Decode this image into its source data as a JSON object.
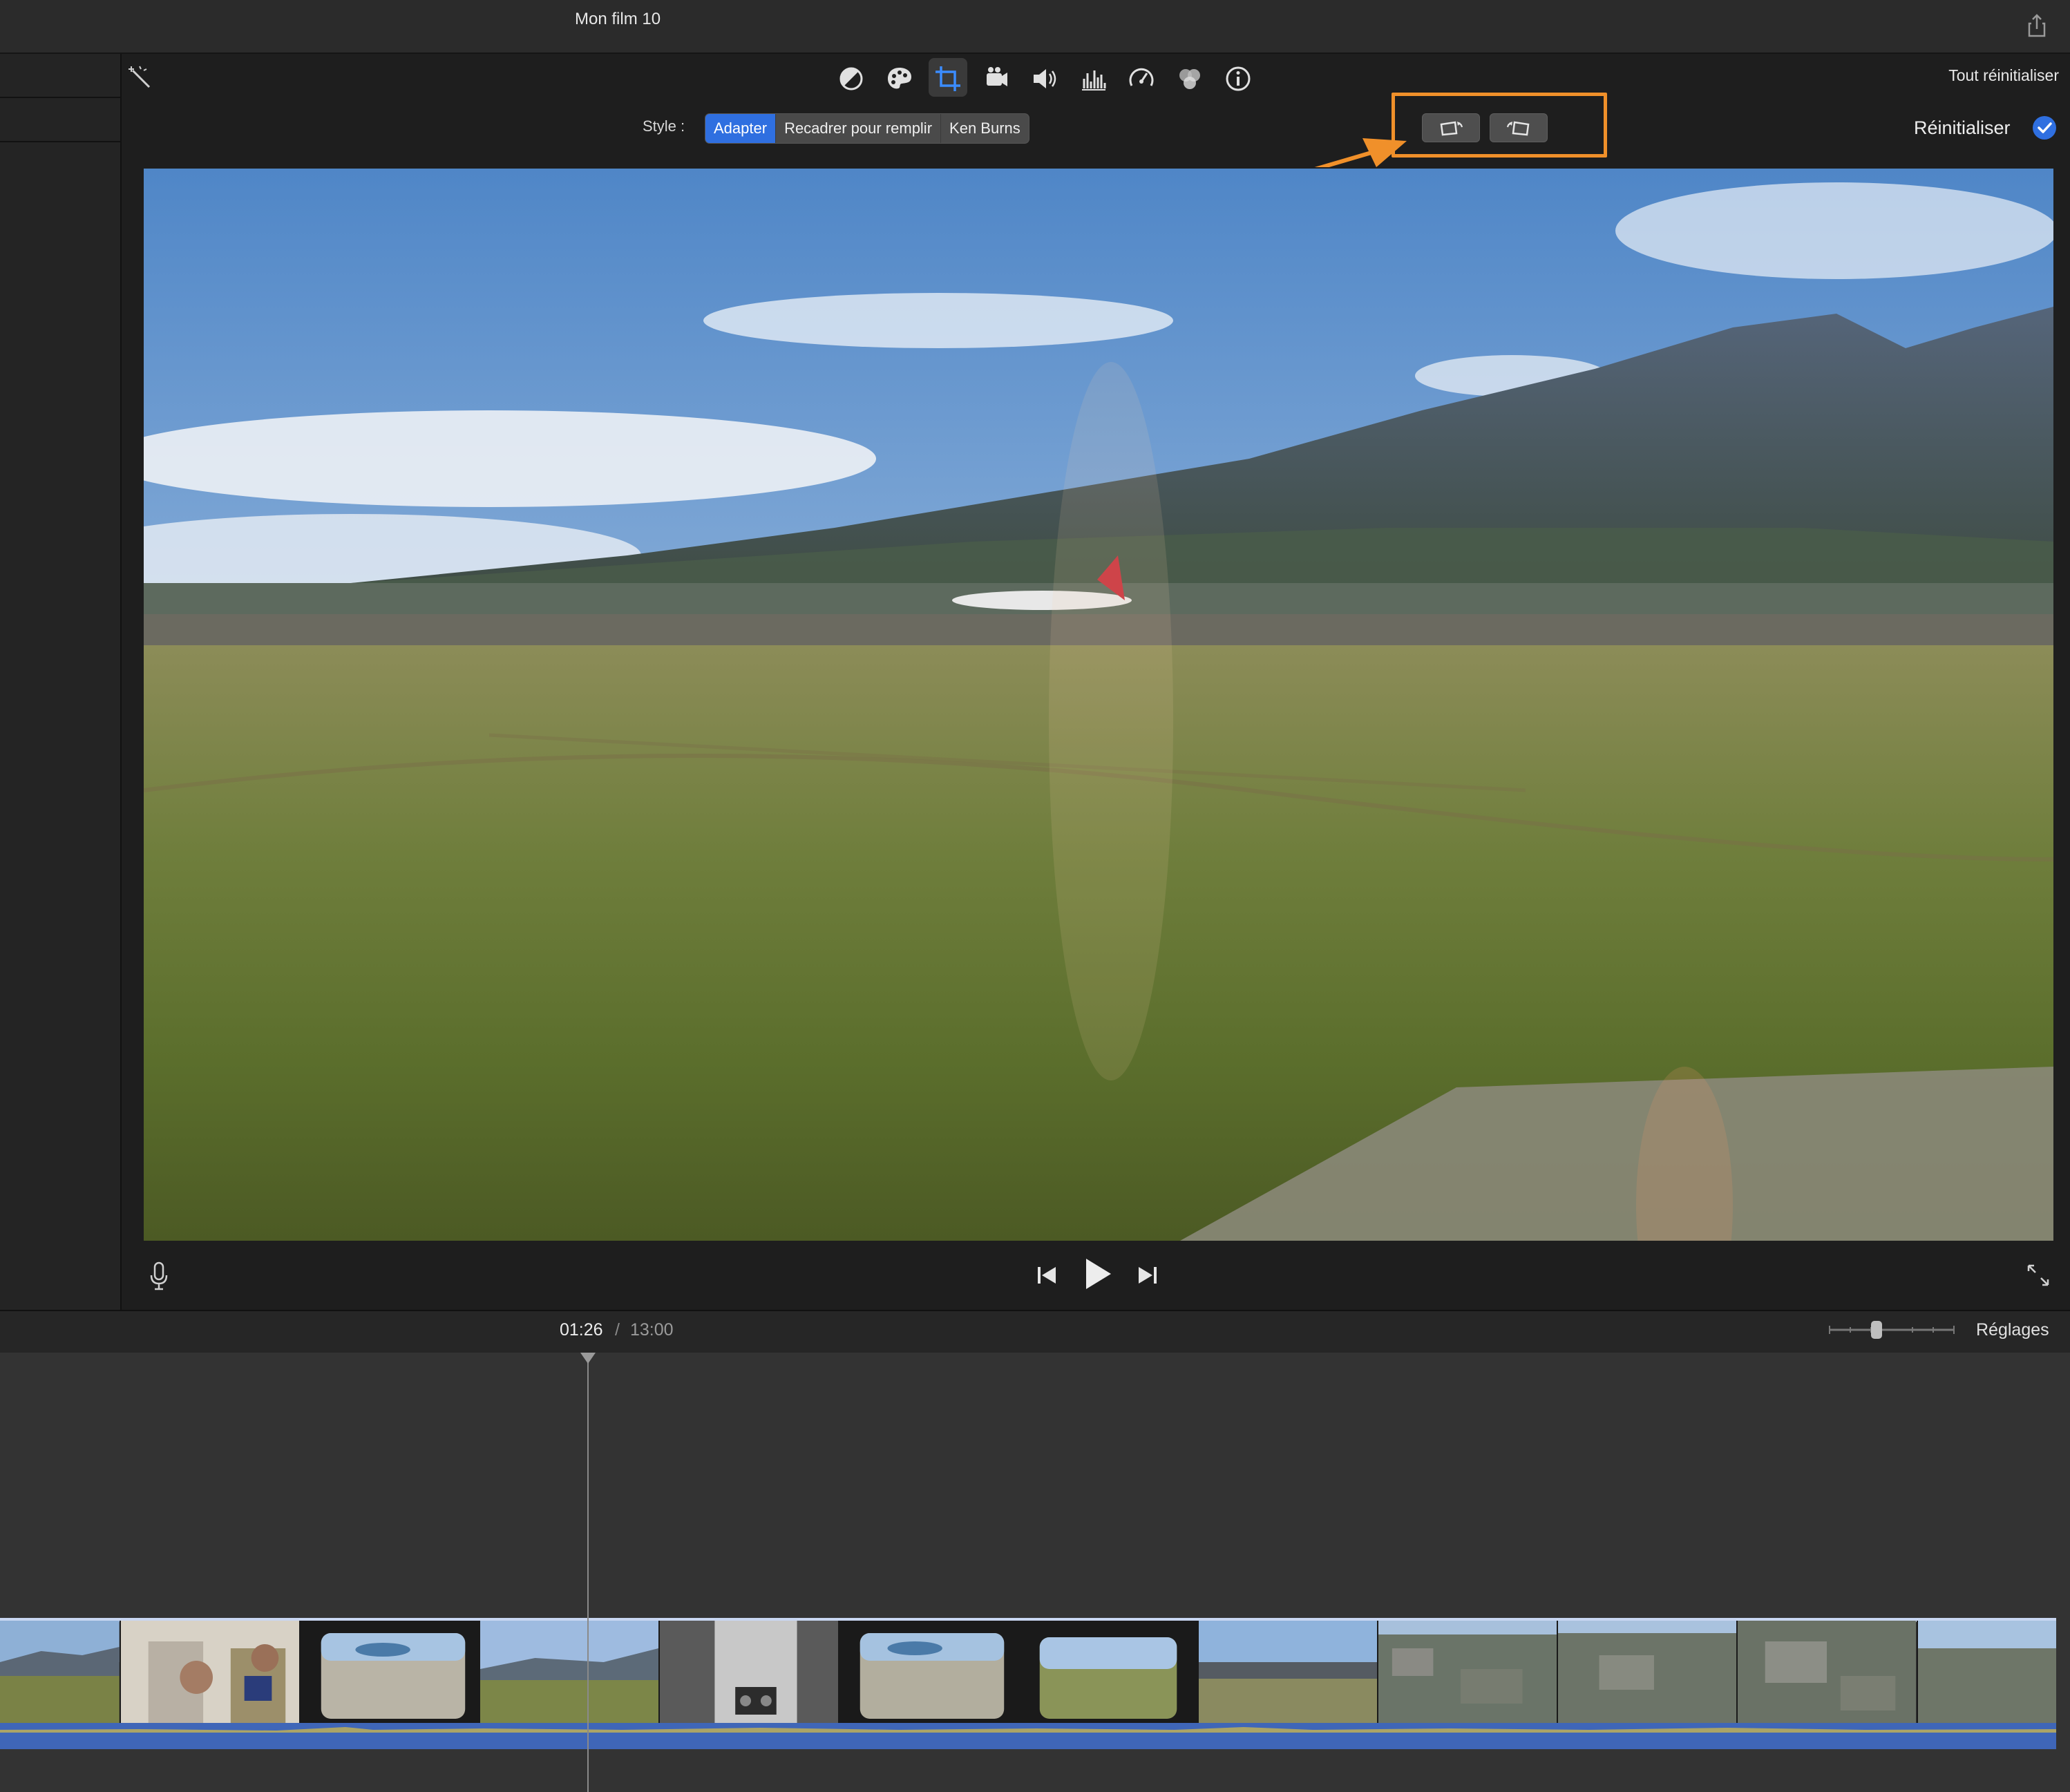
{
  "window": {
    "title": "Mon film 10"
  },
  "toolbar": {
    "tools": [
      {
        "name": "color-balance-icon"
      },
      {
        "name": "color-correction-icon"
      },
      {
        "name": "crop-icon",
        "active": true
      },
      {
        "name": "stabilization-icon"
      },
      {
        "name": "volume-icon"
      },
      {
        "name": "noise-reduction-icon"
      },
      {
        "name": "speed-icon"
      },
      {
        "name": "clip-filter-icon"
      },
      {
        "name": "info-icon"
      }
    ],
    "reset_all": "Tout réinitialiser"
  },
  "crop": {
    "style_label": "Style :",
    "styles": [
      "Adapter",
      "Recadrer pour remplir",
      "Ken Burns"
    ],
    "selected_style": "Adapter",
    "rotate_left": "rotate-left-icon",
    "rotate_right": "rotate-right-icon",
    "reset": "Réinitialiser"
  },
  "accent": {
    "highlight": "#f0902a",
    "selected": "#2f6fe0"
  },
  "playback": {
    "current": "01:26",
    "separator": "/",
    "total": "13:00"
  },
  "timeline": {
    "settings": "Réglages"
  }
}
